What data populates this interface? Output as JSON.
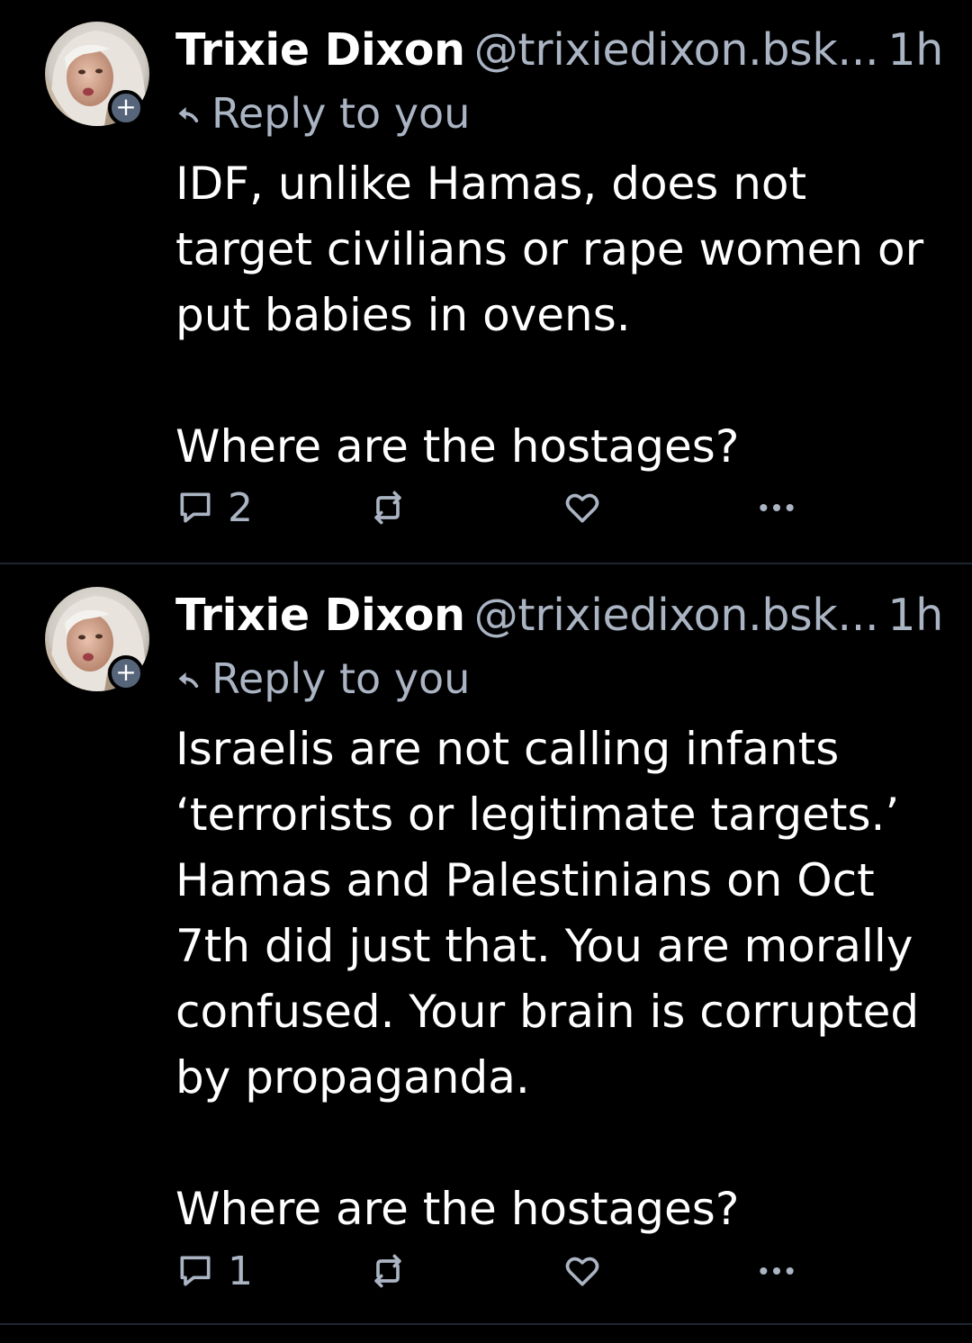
{
  "theme": {
    "background": "#000000",
    "text": "#ffffff",
    "muted": "#aab4c3",
    "badge": "#56657a",
    "divider": "#1e2530"
  },
  "posts": [
    {
      "author_name": "Trixie Dixon",
      "author_handle": "@trixiedixon.bsk...",
      "time": "1h",
      "reply_label": "Reply to you",
      "follow_badge": "+",
      "text": "IDF, unlike Hamas, does not\ntarget civilians or rape women or\nput babies in ovens.\n\nWhere are the hostages?",
      "reply_count": "2",
      "icons": {
        "avatar": "profile-photo",
        "follow": "plus-badge-icon",
        "reply_to": "reply-arrow-icon",
        "reply": "speech-bubble-icon",
        "repost": "repost-icon",
        "like": "heart-icon",
        "more": "ellipsis-icon"
      }
    },
    {
      "author_name": "Trixie Dixon",
      "author_handle": "@trixiedixon.bsk...",
      "time": "1h",
      "reply_label": "Reply to you",
      "follow_badge": "+",
      "text": "Israelis are not calling infants\n‘terrorists or legitimate targets.’\nHamas and Palestinians on Oct\n7th did just that. You are morally\nconfused. Your brain is corrupted\nby propaganda.\n\nWhere are the hostages?",
      "reply_count": "1",
      "icons": {
        "avatar": "profile-photo",
        "follow": "plus-badge-icon",
        "reply_to": "reply-arrow-icon",
        "reply": "speech-bubble-icon",
        "repost": "repost-icon",
        "like": "heart-icon",
        "more": "ellipsis-icon"
      }
    }
  ]
}
